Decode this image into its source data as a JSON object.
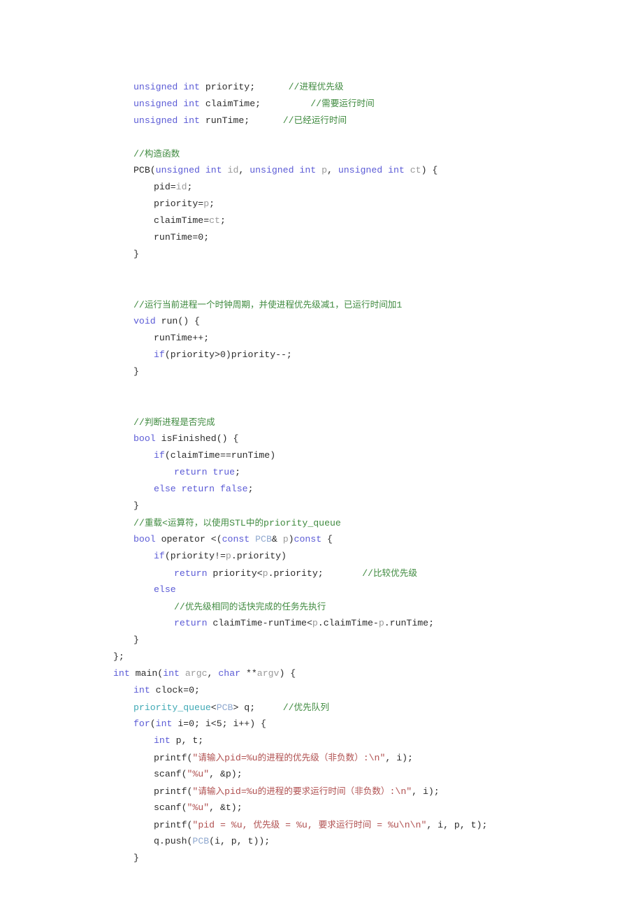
{
  "document": {
    "type": "source-code-listing",
    "language": "C++",
    "page_background": "#ffffff",
    "colors": {
      "keyword": "#5b5bd6",
      "comment": "#3f8a3f",
      "string": "#b05050",
      "type": "#3fa9b5",
      "class_name": "#8fa8cf",
      "parameter": "#9a9a9a",
      "plain_text": "#2b2b2b"
    }
  },
  "code": {
    "lines": [
      {
        "id": "line-1",
        "indent": 1,
        "tokens": [
          {
            "t": "unsigned int ",
            "c": "kw"
          },
          {
            "t": "priority;",
            "c": "plain"
          },
          {
            "t": "      ",
            "c": "plain"
          },
          {
            "t": "//进程优先级",
            "c": "cmt"
          }
        ]
      },
      {
        "id": "line-2",
        "indent": 1,
        "tokens": [
          {
            "t": "unsigned int ",
            "c": "kw"
          },
          {
            "t": "claimTime;",
            "c": "plain"
          },
          {
            "t": "         ",
            "c": "plain"
          },
          {
            "t": "//需要运行时间",
            "c": "cmt"
          }
        ]
      },
      {
        "id": "line-3",
        "indent": 1,
        "tokens": [
          {
            "t": "unsigned int ",
            "c": "kw"
          },
          {
            "t": "runTime;",
            "c": "plain"
          },
          {
            "t": "      ",
            "c": "plain"
          },
          {
            "t": "//已经运行时间",
            "c": "cmt"
          }
        ]
      },
      {
        "id": "line-4",
        "indent": 0,
        "tokens": []
      },
      {
        "id": "line-5",
        "indent": 1,
        "tokens": [
          {
            "t": "//构造函数",
            "c": "cmt"
          }
        ]
      },
      {
        "id": "line-6",
        "indent": 1,
        "tokens": [
          {
            "t": "PCB(",
            "c": "plain"
          },
          {
            "t": "unsigned int ",
            "c": "kw"
          },
          {
            "t": "id",
            "c": "parm"
          },
          {
            "t": ", ",
            "c": "plain"
          },
          {
            "t": "unsigned int ",
            "c": "kw"
          },
          {
            "t": "p",
            "c": "parm"
          },
          {
            "t": ", ",
            "c": "plain"
          },
          {
            "t": "unsigned int ",
            "c": "kw"
          },
          {
            "t": "ct",
            "c": "parm"
          },
          {
            "t": ") {",
            "c": "plain"
          }
        ]
      },
      {
        "id": "line-7",
        "indent": 2,
        "tokens": [
          {
            "t": "pid=",
            "c": "plain"
          },
          {
            "t": "id",
            "c": "parm"
          },
          {
            "t": ";",
            "c": "plain"
          }
        ]
      },
      {
        "id": "line-8",
        "indent": 2,
        "tokens": [
          {
            "t": "priority=",
            "c": "plain"
          },
          {
            "t": "p",
            "c": "parm"
          },
          {
            "t": ";",
            "c": "plain"
          }
        ]
      },
      {
        "id": "line-9",
        "indent": 2,
        "tokens": [
          {
            "t": "claimTime=",
            "c": "plain"
          },
          {
            "t": "ct",
            "c": "parm"
          },
          {
            "t": ";",
            "c": "plain"
          }
        ]
      },
      {
        "id": "line-10",
        "indent": 2,
        "tokens": [
          {
            "t": "runTime=0;",
            "c": "plain"
          }
        ]
      },
      {
        "id": "line-11",
        "indent": 1,
        "tokens": [
          {
            "t": "}",
            "c": "plain"
          }
        ]
      },
      {
        "id": "line-12",
        "indent": 0,
        "tokens": []
      },
      {
        "id": "line-13",
        "indent": 0,
        "tokens": []
      },
      {
        "id": "line-14",
        "indent": 1,
        "tokens": [
          {
            "t": "//运行当前进程一个时钟周期，并使进程优先级减1，已运行时间加1",
            "c": "cmt"
          }
        ]
      },
      {
        "id": "line-15",
        "indent": 1,
        "tokens": [
          {
            "t": "void ",
            "c": "kw"
          },
          {
            "t": "run() {",
            "c": "plain"
          }
        ]
      },
      {
        "id": "line-16",
        "indent": 2,
        "tokens": [
          {
            "t": "runTime++;",
            "c": "plain"
          }
        ]
      },
      {
        "id": "line-17",
        "indent": 2,
        "tokens": [
          {
            "t": "if",
            "c": "kw"
          },
          {
            "t": "(priority>0)priority--;",
            "c": "plain"
          }
        ]
      },
      {
        "id": "line-18",
        "indent": 1,
        "tokens": [
          {
            "t": "}",
            "c": "plain"
          }
        ]
      },
      {
        "id": "line-19",
        "indent": 0,
        "tokens": []
      },
      {
        "id": "line-20",
        "indent": 0,
        "tokens": []
      },
      {
        "id": "line-21",
        "indent": 1,
        "tokens": [
          {
            "t": "//判断进程是否完成",
            "c": "cmt"
          }
        ]
      },
      {
        "id": "line-22",
        "indent": 1,
        "tokens": [
          {
            "t": "bool ",
            "c": "kw"
          },
          {
            "t": "isFinished() {",
            "c": "plain"
          }
        ]
      },
      {
        "id": "line-23",
        "indent": 2,
        "tokens": [
          {
            "t": "if",
            "c": "kw"
          },
          {
            "t": "(claimTime==runTime)",
            "c": "plain"
          }
        ]
      },
      {
        "id": "line-24",
        "indent": 3,
        "tokens": [
          {
            "t": "return ",
            "c": "kw"
          },
          {
            "t": "true",
            "c": "kw"
          },
          {
            "t": ";",
            "c": "plain"
          }
        ]
      },
      {
        "id": "line-25",
        "indent": 2,
        "tokens": [
          {
            "t": "else ",
            "c": "kw"
          },
          {
            "t": "return ",
            "c": "kw"
          },
          {
            "t": "false",
            "c": "kw"
          },
          {
            "t": ";",
            "c": "plain"
          }
        ]
      },
      {
        "id": "line-26",
        "indent": 1,
        "tokens": [
          {
            "t": "}",
            "c": "plain"
          }
        ]
      },
      {
        "id": "line-27",
        "indent": 1,
        "tokens": [
          {
            "t": "//重载<运算符，以使用STL中的priority_queue",
            "c": "cmt"
          }
        ]
      },
      {
        "id": "line-28",
        "indent": 1,
        "tokens": [
          {
            "t": "bool ",
            "c": "kw"
          },
          {
            "t": "operator <(",
            "c": "plain"
          },
          {
            "t": "const ",
            "c": "kw"
          },
          {
            "t": "PCB",
            "c": "cls"
          },
          {
            "t": "& ",
            "c": "plain"
          },
          {
            "t": "p",
            "c": "parm"
          },
          {
            "t": ")",
            "c": "plain"
          },
          {
            "t": "const",
            "c": "kw"
          },
          {
            "t": " {",
            "c": "plain"
          }
        ]
      },
      {
        "id": "line-29",
        "indent": 2,
        "tokens": [
          {
            "t": "if",
            "c": "kw"
          },
          {
            "t": "(priority!=",
            "c": "plain"
          },
          {
            "t": "p",
            "c": "parm"
          },
          {
            "t": ".priority)",
            "c": "plain"
          }
        ]
      },
      {
        "id": "line-30",
        "indent": 3,
        "tokens": [
          {
            "t": "return ",
            "c": "kw"
          },
          {
            "t": "priority<",
            "c": "plain"
          },
          {
            "t": "p",
            "c": "parm"
          },
          {
            "t": ".priority;",
            "c": "plain"
          },
          {
            "t": "       ",
            "c": "plain"
          },
          {
            "t": "//比较优先级",
            "c": "cmt"
          }
        ]
      },
      {
        "id": "line-31",
        "indent": 2,
        "tokens": [
          {
            "t": "else",
            "c": "kw"
          }
        ]
      },
      {
        "id": "line-32",
        "indent": 3,
        "tokens": [
          {
            "t": "//优先级相同的话快完成的任务先执行",
            "c": "cmt"
          }
        ]
      },
      {
        "id": "line-33",
        "indent": 3,
        "tokens": [
          {
            "t": "return ",
            "c": "kw"
          },
          {
            "t": "claimTime-runTime<",
            "c": "plain"
          },
          {
            "t": "p",
            "c": "parm"
          },
          {
            "t": ".claimTime-",
            "c": "plain"
          },
          {
            "t": "p",
            "c": "parm"
          },
          {
            "t": ".runTime;",
            "c": "plain"
          }
        ]
      },
      {
        "id": "line-34",
        "indent": 1,
        "tokens": [
          {
            "t": "}",
            "c": "plain"
          }
        ]
      },
      {
        "id": "line-35",
        "indent": 0,
        "tokens": [
          {
            "t": "};",
            "c": "plain"
          }
        ]
      },
      {
        "id": "line-36",
        "indent": 0,
        "tokens": [
          {
            "t": "int ",
            "c": "kw"
          },
          {
            "t": "main(",
            "c": "plain"
          },
          {
            "t": "int ",
            "c": "kw"
          },
          {
            "t": "argc",
            "c": "parm"
          },
          {
            "t": ", ",
            "c": "plain"
          },
          {
            "t": "char ",
            "c": "kw"
          },
          {
            "t": "**",
            "c": "plain"
          },
          {
            "t": "argv",
            "c": "parm"
          },
          {
            "t": ") {",
            "c": "plain"
          }
        ]
      },
      {
        "id": "line-37",
        "indent": 1,
        "tokens": [
          {
            "t": "int ",
            "c": "kw"
          },
          {
            "t": "clock=0;",
            "c": "plain"
          }
        ]
      },
      {
        "id": "line-38",
        "indent": 1,
        "tokens": [
          {
            "t": "priority_queue",
            "c": "type"
          },
          {
            "t": "<",
            "c": "plain"
          },
          {
            "t": "PCB",
            "c": "cls"
          },
          {
            "t": "> q;",
            "c": "plain"
          },
          {
            "t": "     ",
            "c": "plain"
          },
          {
            "t": "//优先队列",
            "c": "cmt"
          }
        ]
      },
      {
        "id": "line-39",
        "indent": 1,
        "tokens": [
          {
            "t": "for",
            "c": "kw"
          },
          {
            "t": "(",
            "c": "plain"
          },
          {
            "t": "int ",
            "c": "kw"
          },
          {
            "t": "i=0; i<5; i++) {",
            "c": "plain"
          }
        ]
      },
      {
        "id": "line-40",
        "indent": 2,
        "tokens": [
          {
            "t": "int ",
            "c": "kw"
          },
          {
            "t": "p, t;",
            "c": "plain"
          }
        ]
      },
      {
        "id": "line-41",
        "indent": 2,
        "tokens": [
          {
            "t": "printf(",
            "c": "plain"
          },
          {
            "t": "\"请输入pid=%u的进程的优先级（非负数）:\\n\"",
            "c": "str"
          },
          {
            "t": ", i);",
            "c": "plain"
          }
        ]
      },
      {
        "id": "line-42",
        "indent": 2,
        "tokens": [
          {
            "t": "scanf(",
            "c": "plain"
          },
          {
            "t": "\"%u\"",
            "c": "str"
          },
          {
            "t": ", &p);",
            "c": "plain"
          }
        ]
      },
      {
        "id": "line-43",
        "indent": 2,
        "tokens": [
          {
            "t": "printf(",
            "c": "plain"
          },
          {
            "t": "\"请输入pid=%u的进程的要求运行时间（非负数）:\\n\"",
            "c": "str"
          },
          {
            "t": ", i);",
            "c": "plain"
          }
        ]
      },
      {
        "id": "line-44",
        "indent": 2,
        "tokens": [
          {
            "t": "scanf(",
            "c": "plain"
          },
          {
            "t": "\"%u\"",
            "c": "str"
          },
          {
            "t": ", &t);",
            "c": "plain"
          }
        ]
      },
      {
        "id": "line-45",
        "indent": 2,
        "tokens": [
          {
            "t": "printf(",
            "c": "plain"
          },
          {
            "t": "\"pid = %u, 优先级 = %u, 要求运行时间 = %u\\n\\n\"",
            "c": "str"
          },
          {
            "t": ", i, p, t);",
            "c": "plain"
          }
        ]
      },
      {
        "id": "line-46",
        "indent": 2,
        "tokens": [
          {
            "t": "q.push(",
            "c": "plain"
          },
          {
            "t": "PCB",
            "c": "cls"
          },
          {
            "t": "(i, p, t));",
            "c": "plain"
          }
        ]
      },
      {
        "id": "line-47",
        "indent": 1,
        "tokens": [
          {
            "t": "}",
            "c": "plain"
          }
        ]
      }
    ]
  }
}
